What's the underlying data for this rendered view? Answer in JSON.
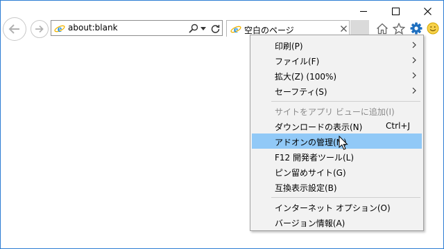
{
  "address_bar": {
    "url": "about:blank"
  },
  "tab": {
    "title": "空白のページ"
  },
  "menu": {
    "items": [
      {
        "label": "印刷(P)",
        "submenu": true
      },
      {
        "label": "ファイル(F)",
        "submenu": true
      },
      {
        "label": "拡大(Z) (100%)",
        "submenu": true
      },
      {
        "label": "セーフティ(S)",
        "submenu": true
      },
      {
        "label": "サイトをアプリ ビューに追加(I)",
        "disabled": true
      },
      {
        "label": "ダウンロードの表示(N)",
        "shortcut": "Ctrl+J"
      },
      {
        "label": "アドオンの管理(M)",
        "highlighted": true
      },
      {
        "label": "F12 開発者ツール(L)"
      },
      {
        "label": "ピン留めサイト(G)"
      },
      {
        "label": "互換表示設定(B)"
      },
      {
        "label": "インターネット オプション(O)"
      },
      {
        "label": "バージョン情報(A)"
      }
    ]
  },
  "icons": [
    "back-arrow-icon",
    "forward-arrow-icon",
    "ie-logo-icon",
    "search-icon",
    "dropdown-icon",
    "refresh-icon",
    "close-icon",
    "home-icon",
    "star-icon",
    "gear-icon",
    "smiley-icon",
    "minimize-icon",
    "maximize-icon",
    "cursor-icon"
  ],
  "colors": {
    "accent": "#2b7cd3",
    "menu_highlight": "#91c9f7",
    "gear": "#1e6fbf"
  }
}
